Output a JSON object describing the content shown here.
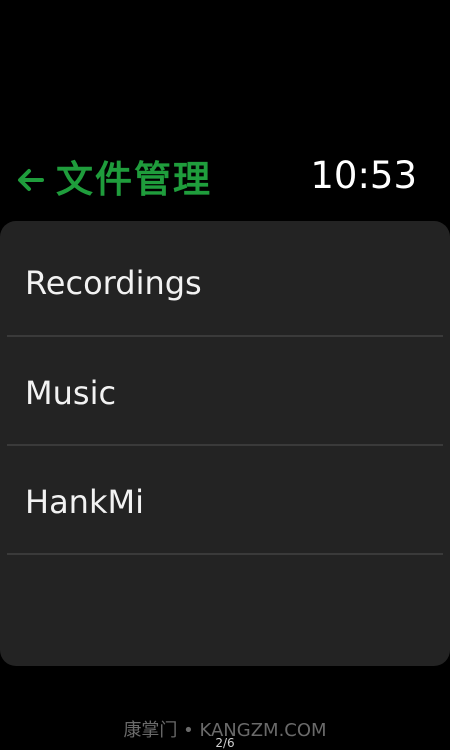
{
  "header": {
    "title": "文件管理",
    "back_icon": "arrow-left-icon",
    "time": "10:53",
    "accent_color": "#1f9d3c"
  },
  "list": {
    "items": [
      {
        "label": "Recordings"
      },
      {
        "label": "Music"
      },
      {
        "label": "HankMi"
      }
    ]
  },
  "footer": {
    "watermark": "康掌门 • KANGZM.COM",
    "page_indicator": "2/6"
  }
}
